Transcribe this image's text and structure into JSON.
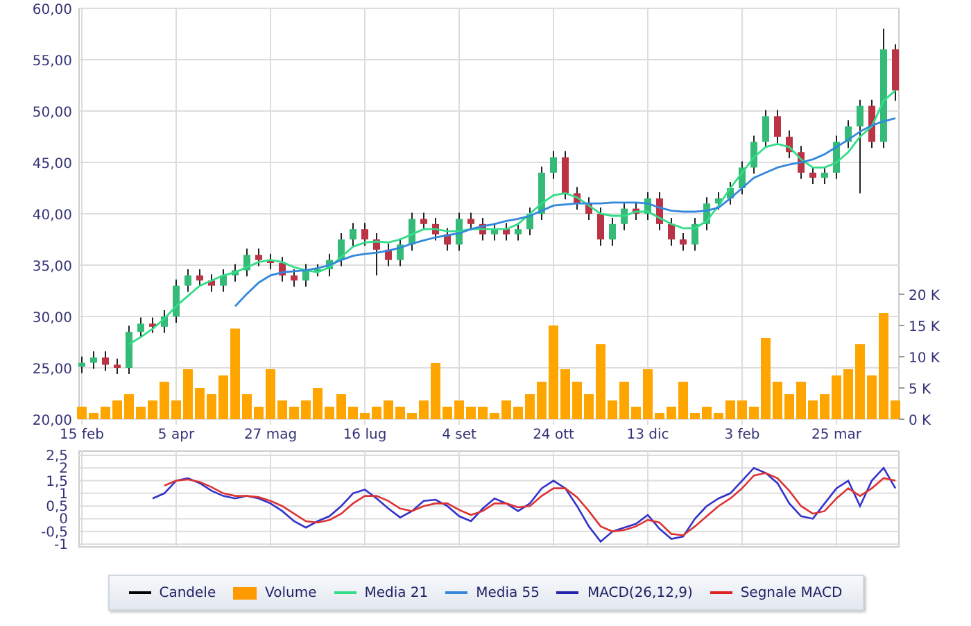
{
  "price_chart": {
    "chart_data": {
      "type": "candlestick",
      "ylim": [
        20,
        60
      ],
      "grid": true,
      "yticks": [
        {
          "value": 60,
          "label": "60,00"
        },
        {
          "value": 55,
          "label": "55,00"
        },
        {
          "value": 50,
          "label": "50,00"
        },
        {
          "value": 45,
          "label": "45,00"
        },
        {
          "value": 40,
          "label": "40,00"
        },
        {
          "value": 35,
          "label": "35,00"
        },
        {
          "value": 30,
          "label": "30,00"
        },
        {
          "value": 25,
          "label": "25,00"
        },
        {
          "value": 20,
          "label": "20,00"
        }
      ],
      "categories": [
        "15 feb",
        null,
        null,
        null,
        null,
        null,
        null,
        null,
        "5 apr",
        null,
        null,
        null,
        null,
        null,
        null,
        null,
        "27 mag",
        null,
        null,
        null,
        null,
        null,
        null,
        null,
        "16 lug",
        null,
        null,
        null,
        null,
        null,
        null,
        null,
        "4 set",
        null,
        null,
        null,
        null,
        null,
        null,
        null,
        "24 ott",
        null,
        null,
        null,
        null,
        null,
        null,
        null,
        "13 dic",
        null,
        null,
        null,
        null,
        null,
        null,
        null,
        "3 feb",
        null,
        null,
        null,
        null,
        null,
        null,
        null,
        "25 mar",
        null,
        null,
        null,
        null,
        null
      ],
      "ohlc": [
        [
          25.1,
          26.1,
          24.5,
          25.5
        ],
        [
          25.5,
          26.6,
          24.9,
          26
        ],
        [
          26,
          26.6,
          24.7,
          25.3
        ],
        [
          25.3,
          25.9,
          24.4,
          25
        ],
        [
          25,
          29.1,
          24.4,
          28.5
        ],
        [
          28.5,
          29.9,
          27.9,
          29.3
        ],
        [
          29.3,
          29.9,
          28.4,
          29
        ],
        [
          29,
          30.6,
          28.4,
          30
        ],
        [
          30,
          33.6,
          29.4,
          33
        ],
        [
          33,
          34.6,
          32.4,
          34
        ],
        [
          34,
          34.6,
          32.9,
          33.5
        ],
        [
          33.5,
          34.1,
          32.4,
          33
        ],
        [
          33,
          34.6,
          32.4,
          34
        ],
        [
          34,
          35.1,
          33.4,
          34.5
        ],
        [
          34.5,
          36.6,
          33.9,
          36
        ],
        [
          36,
          36.6,
          34.9,
          35.5
        ],
        [
          35.5,
          36.1,
          34.6,
          35.2
        ],
        [
          35.2,
          35.8,
          33.4,
          34
        ],
        [
          34,
          34.6,
          32.9,
          33.5
        ],
        [
          33.5,
          35.1,
          32.9,
          34.5
        ],
        [
          34.5,
          35.1,
          33.9,
          34.6
        ],
        [
          34.6,
          36.1,
          33.9,
          35.5
        ],
        [
          35.5,
          38.1,
          34.9,
          37.5
        ],
        [
          37.5,
          39.1,
          36.9,
          38.5
        ],
        [
          38.5,
          39.1,
          36.9,
          37.5
        ],
        [
          37.5,
          38.1,
          34,
          36.5
        ],
        [
          36.5,
          37.1,
          34.9,
          35.5
        ],
        [
          35.5,
          37.6,
          34.9,
          37
        ],
        [
          37,
          40.1,
          36.4,
          39.5
        ],
        [
          39.5,
          40.1,
          38.4,
          39
        ],
        [
          39,
          39.6,
          37.4,
          38
        ],
        [
          38,
          38.6,
          36.4,
          37
        ],
        [
          37,
          40.1,
          36.4,
          39.5
        ],
        [
          39.5,
          40.1,
          38.4,
          39
        ],
        [
          39,
          39.6,
          37.4,
          38
        ],
        [
          38,
          39.1,
          37.4,
          38.5
        ],
        [
          38.5,
          39.1,
          37.4,
          38
        ],
        [
          38,
          39.1,
          37.4,
          38.5
        ],
        [
          38.5,
          40.6,
          37.9,
          40
        ],
        [
          40,
          44.6,
          39.4,
          44
        ],
        [
          44,
          46.1,
          43.4,
          45.5
        ],
        [
          45.5,
          46.1,
          41.4,
          42
        ],
        [
          42,
          42.6,
          40.4,
          41
        ],
        [
          41,
          41.6,
          39.4,
          40
        ],
        [
          40,
          40.6,
          36.9,
          37.5
        ],
        [
          37.5,
          39.6,
          36.9,
          39
        ],
        [
          39,
          41.1,
          38.4,
          40.5
        ],
        [
          40.5,
          41.1,
          39.4,
          40
        ],
        [
          40,
          42.1,
          39.4,
          41.5
        ],
        [
          41.5,
          42.1,
          38.4,
          39
        ],
        [
          39,
          39.6,
          36.9,
          37.5
        ],
        [
          37.5,
          38.1,
          36.4,
          37
        ],
        [
          37,
          39.6,
          36.4,
          39
        ],
        [
          39,
          41.6,
          38.4,
          41
        ],
        [
          41,
          42.1,
          40.4,
          41.5
        ],
        [
          41.5,
          43.1,
          40.9,
          42.5
        ],
        [
          42.5,
          45.1,
          41.9,
          44.5
        ],
        [
          44.5,
          47.6,
          43.9,
          47
        ],
        [
          47,
          50.1,
          46.4,
          49.5
        ],
        [
          49.5,
          50.1,
          46.9,
          47.5
        ],
        [
          47.5,
          48.1,
          45.4,
          46
        ],
        [
          46,
          46.6,
          43.4,
          44
        ],
        [
          44,
          44.6,
          42.9,
          43.5
        ],
        [
          43.5,
          44.6,
          42.9,
          44
        ],
        [
          44,
          47.6,
          43.4,
          47
        ],
        [
          47,
          49.1,
          46.4,
          48.5
        ],
        [
          48.5,
          51.1,
          42,
          50.5
        ],
        [
          50.5,
          51.1,
          46.4,
          47
        ],
        [
          47,
          58,
          46.4,
          56
        ],
        [
          56,
          56.5,
          51,
          52
        ]
      ],
      "series": [
        {
          "type": "line",
          "color": "#33dd88",
          "values": [
            null,
            null,
            null,
            null,
            27.3,
            28,
            28.8,
            29.8,
            31,
            32,
            33,
            33.5,
            34,
            34.3,
            34.8,
            35.3,
            35.5,
            35.3,
            34.8,
            34.5,
            34.3,
            34.8,
            35.8,
            36.8,
            37.2,
            37.3,
            37.2,
            37.5,
            38,
            38.5,
            38.5,
            38.3,
            38.3,
            38.5,
            38.5,
            38.5,
            38.5,
            39,
            40,
            41,
            41.8,
            42,
            41.6,
            40.8,
            40,
            39.8,
            39.8,
            40.2,
            40.2,
            39.6,
            39,
            38.6,
            38.6,
            39.3,
            40.8,
            42.5,
            44,
            45.5,
            46.5,
            46.8,
            46.5,
            45.3,
            44.5,
            44.5,
            45,
            46,
            47.5,
            48.5,
            51,
            52
          ]
        },
        {
          "type": "line",
          "color": "#3388dd",
          "values": [
            null,
            null,
            null,
            null,
            null,
            null,
            null,
            null,
            null,
            null,
            null,
            null,
            null,
            31,
            32.2,
            33.3,
            34,
            34.3,
            34.4,
            34.5,
            34.7,
            35,
            35.5,
            35.9,
            36.1,
            36.2,
            36.4,
            36.7,
            37.1,
            37.4,
            37.7,
            37.9,
            38.1,
            38.5,
            38.8,
            39,
            39.3,
            39.5,
            39.8,
            40.3,
            40.8,
            40.9,
            41,
            41,
            41,
            41.1,
            41.1,
            41.1,
            41,
            40.6,
            40.3,
            40.2,
            40.2,
            40.3,
            40.6,
            41.5,
            42.5,
            43.5,
            44,
            44.5,
            44.8,
            45,
            45.3,
            45.8,
            46.5,
            47.2,
            48,
            48.6,
            49,
            49.3
          ]
        }
      ]
    }
  },
  "volume_chart": {
    "chart_data": {
      "type": "bar",
      "ylim": [
        0,
        20
      ],
      "yticks": [
        {
          "value": 20,
          "label": "20 K"
        },
        {
          "value": 15,
          "label": "15 K"
        },
        {
          "value": 10,
          "label": "10 K"
        },
        {
          "value": 5,
          "label": "5 K"
        },
        {
          "value": 0,
          "label": "0 K"
        }
      ],
      "categories": [
        null,
        null,
        null,
        null,
        null,
        null,
        null,
        null,
        null,
        null,
        null,
        null,
        null,
        null,
        null,
        null,
        null,
        null,
        null,
        null,
        null,
        null,
        null,
        null,
        null,
        null,
        null,
        null,
        null,
        null,
        null,
        null,
        null,
        null,
        null,
        null,
        null,
        null,
        null,
        null,
        null,
        null,
        null,
        null,
        null,
        null,
        null,
        null,
        null,
        null,
        null,
        null,
        null,
        null,
        null,
        null,
        null,
        null,
        null,
        null,
        null,
        null,
        null,
        null,
        null,
        null,
        null,
        null,
        null,
        null
      ],
      "series": [
        {
          "color": "#ffa500",
          "values": [
            2,
            1,
            2,
            3,
            4,
            2,
            3,
            6,
            3,
            8,
            5,
            4,
            7,
            14.5,
            4,
            2,
            8,
            3,
            2,
            3,
            5,
            2,
            4,
            2,
            1,
            2,
            3,
            2,
            1,
            3,
            9,
            2,
            3,
            2,
            2,
            1,
            3,
            2,
            4,
            6,
            15,
            8,
            6,
            4,
            12,
            3,
            6,
            2,
            8,
            1,
            2,
            6,
            1,
            2,
            1,
            3,
            3,
            2,
            13,
            6,
            4,
            6,
            3,
            4,
            7,
            8,
            12,
            7,
            17,
            3
          ]
        }
      ]
    }
  },
  "macd_chart": {
    "chart_data": {
      "type": "line",
      "ylim": [
        -1,
        2.5
      ],
      "grid": true,
      "yticks": [
        {
          "value": 2.5,
          "label": "2,5"
        },
        {
          "value": 2,
          "label": "2"
        },
        {
          "value": 1.5,
          "label": "1,5"
        },
        {
          "value": 1,
          "label": "1"
        },
        {
          "value": 0.5,
          "label": "0,5"
        },
        {
          "value": 0,
          "label": "0"
        },
        {
          "value": -0.5,
          "label": "-0,5"
        },
        {
          "value": -1,
          "label": "-1"
        }
      ],
      "categories": [
        null,
        null,
        null,
        null,
        null,
        null,
        null,
        null,
        null,
        null,
        null,
        null,
        null,
        null,
        null,
        null,
        null,
        null,
        null,
        null,
        null,
        null,
        null,
        null,
        null,
        null,
        null,
        null,
        null,
        null,
        null,
        null,
        null,
        null,
        null,
        null,
        null,
        null,
        null,
        null,
        null,
        null,
        null,
        null,
        null,
        null,
        null,
        null,
        null,
        null,
        null,
        null,
        null,
        null,
        null,
        null,
        null,
        null,
        null,
        null,
        null,
        null,
        null,
        null,
        null,
        null,
        null,
        null,
        null,
        null
      ],
      "series": [
        {
          "color": "#3333cc",
          "values": [
            null,
            null,
            null,
            null,
            null,
            null,
            0.8,
            1.0,
            1.5,
            1.6,
            1.4,
            1.1,
            0.9,
            0.8,
            0.9,
            0.8,
            0.6,
            0.3,
            -0.1,
            -0.35,
            -0.1,
            0.1,
            0.5,
            1.0,
            1.15,
            0.8,
            0.4,
            0.05,
            0.3,
            0.7,
            0.75,
            0.5,
            0.1,
            -0.1,
            0.4,
            0.8,
            0.6,
            0.3,
            0.6,
            1.2,
            1.5,
            1.2,
            0.5,
            -0.3,
            -0.9,
            -0.5,
            -0.35,
            -0.2,
            0.15,
            -0.4,
            -0.8,
            -0.7,
            0.0,
            0.5,
            0.8,
            1.0,
            1.5,
            2.0,
            1.8,
            1.4,
            0.6,
            0.1,
            0.0,
            0.6,
            1.2,
            1.5,
            0.5,
            1.5,
            2.0,
            1.2
          ]
        },
        {
          "color": "#dd3333",
          "values": [
            null,
            null,
            null,
            null,
            null,
            null,
            null,
            1.3,
            1.5,
            1.55,
            1.45,
            1.25,
            1.0,
            0.9,
            0.9,
            0.85,
            0.7,
            0.5,
            0.2,
            -0.1,
            -0.15,
            -0.05,
            0.2,
            0.6,
            0.9,
            0.9,
            0.7,
            0.4,
            0.3,
            0.5,
            0.6,
            0.6,
            0.35,
            0.15,
            0.3,
            0.6,
            0.6,
            0.45,
            0.5,
            0.9,
            1.2,
            1.2,
            0.85,
            0.3,
            -0.3,
            -0.5,
            -0.45,
            -0.3,
            -0.05,
            -0.15,
            -0.6,
            -0.65,
            -0.3,
            0.1,
            0.5,
            0.8,
            1.2,
            1.7,
            1.8,
            1.6,
            1.1,
            0.5,
            0.2,
            0.3,
            0.8,
            1.2,
            0.9,
            1.2,
            1.6,
            1.5
          ]
        }
      ]
    }
  },
  "legend": [
    {
      "label": "Candele",
      "kind": "line",
      "color": "#000000"
    },
    {
      "label": "Volume",
      "kind": "swatch",
      "color": "#ff9900"
    },
    {
      "label": "Media 21",
      "kind": "line",
      "color": "#33dd88"
    },
    {
      "label": "Media 55",
      "kind": "line",
      "color": "#3388dd"
    },
    {
      "label": "MACD(26,12,9)",
      "kind": "line",
      "color": "#2222aa"
    },
    {
      "label": "Segnale MACD",
      "kind": "line",
      "color": "#dd2222"
    }
  ]
}
